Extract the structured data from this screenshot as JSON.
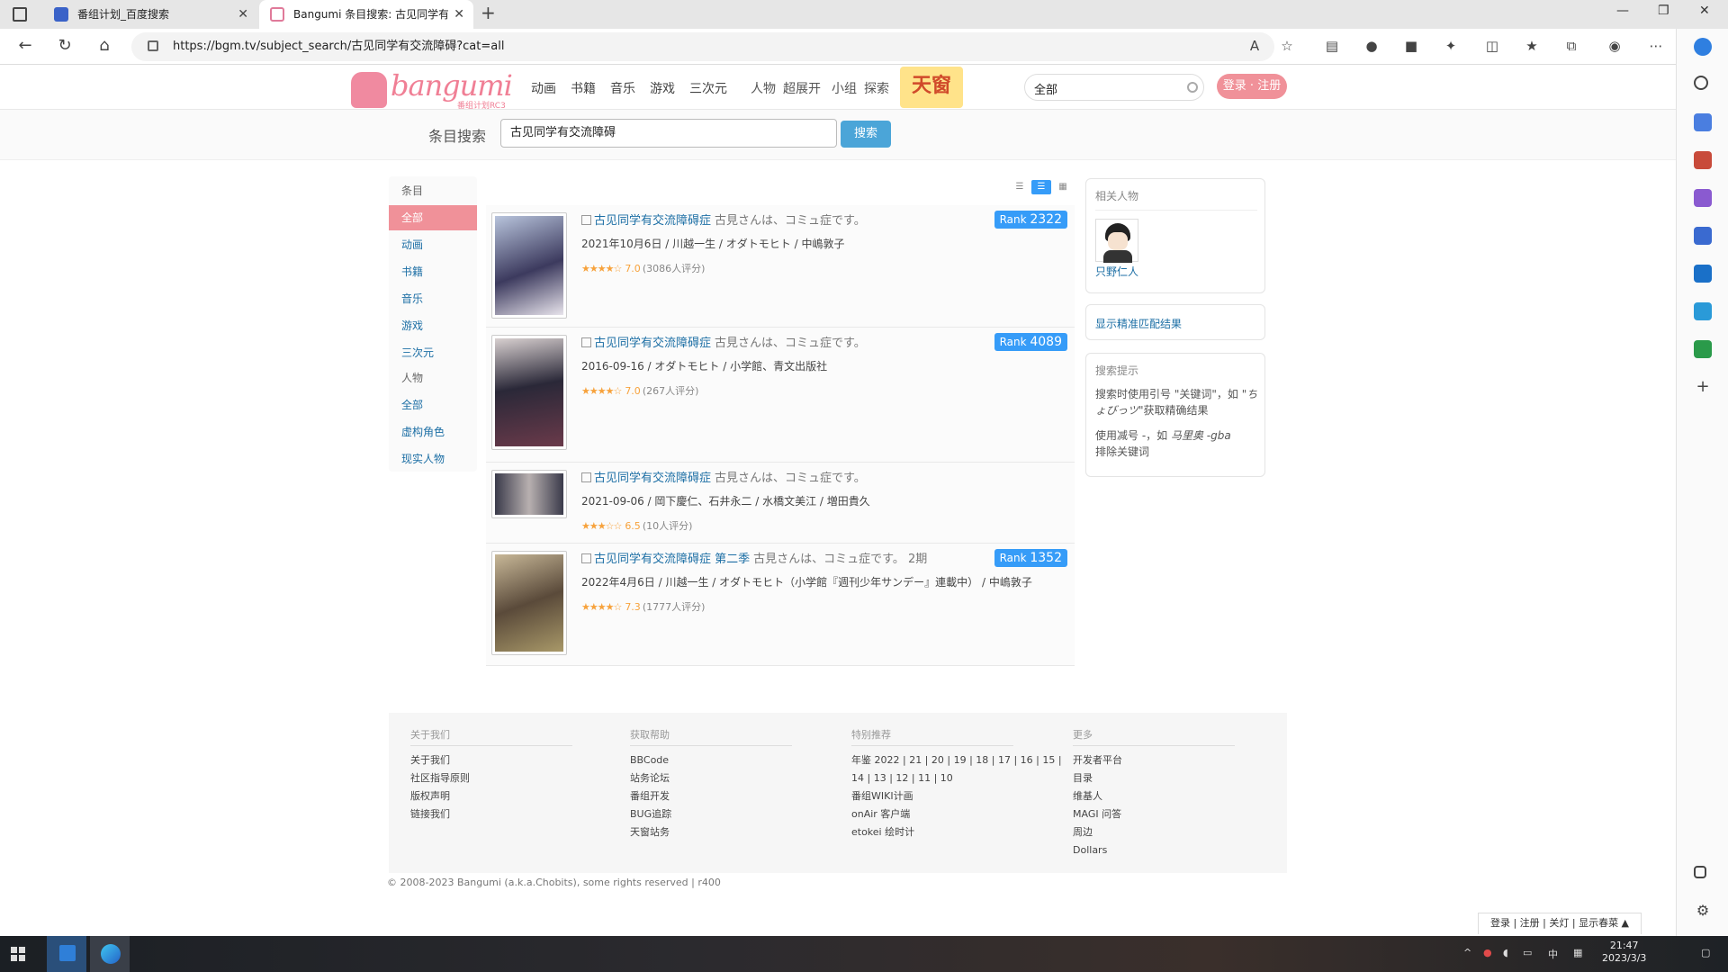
{
  "browser": {
    "tabs": [
      {
        "title": "番组计划_百度搜索"
      },
      {
        "title": "Bangumi 条目搜索: 古见同学有交流障碍症"
      }
    ],
    "url": "https://bgm.tv/subject_search/古见同学有交流障碍?cat=all",
    "icons": [
      "back-icon",
      "refresh-icon",
      "home-icon",
      "read-aloud-icon",
      "favorite-icon",
      "extensions-icon",
      "collections-icon",
      "profile-icon",
      "more-icon",
      "bing-icon"
    ]
  },
  "header": {
    "logo": "bangumi",
    "logo_sub": "番组计划RC3",
    "nav": [
      "动画",
      "书籍",
      "音乐",
      "游戏",
      "三次元"
    ],
    "nav2": [
      "人物",
      "超展开",
      "小组",
      "探索"
    ],
    "promo": "天窗",
    "search_category": "全部",
    "login": "登录 · 注册"
  },
  "searchbar": {
    "title": "条目搜索",
    "query": "古见同学有交流障碍",
    "button": "搜索"
  },
  "categories": [
    {
      "label": "条目",
      "type": "hd"
    },
    {
      "label": "全部",
      "type": "on"
    },
    {
      "label": "动画",
      "type": ""
    },
    {
      "label": "书籍",
      "type": ""
    },
    {
      "label": "音乐",
      "type": ""
    },
    {
      "label": "游戏",
      "type": ""
    },
    {
      "label": "三次元",
      "type": ""
    },
    {
      "label": "人物",
      "type": "hd"
    },
    {
      "label": "全部",
      "type": ""
    },
    {
      "label": "虚构角色",
      "type": ""
    },
    {
      "label": "现实人物",
      "type": ""
    }
  ],
  "results": [
    {
      "title": "古见同学有交流障碍症",
      "jp": "古見さんは、コミュ症です。",
      "info": "2021年10月6日 / 川越一生 / オダトモヒト / 中嶋敦子",
      "stars": 3.5,
      "score": "7.0",
      "votes": "(3086人评分)",
      "rank": "2322",
      "type_icon": "tv-icon"
    },
    {
      "title": "古见同学有交流障碍症",
      "jp": "古見さんは、コミュ症です。",
      "info": "2016-09-16 / オダトモヒト / 小学館、青文出版社",
      "stars": 3.5,
      "score": "7.0",
      "votes": "(267人评分)",
      "rank": "4089",
      "type_icon": "book-icon"
    },
    {
      "title": "古见同学有交流障碍症",
      "jp": "古見さんは、コミュ症です。",
      "info": "2021-09-06 / 岡下慶仁、石井永二 / 水橋文美江 / 増田貴久",
      "stars": 3,
      "score": "6.5",
      "votes": "(10人评分)",
      "rank": "",
      "type_icon": "real-icon"
    },
    {
      "title": "古见同学有交流障碍症 第二季",
      "jp": "古見さんは、コミュ症です。 2期",
      "info": "2022年4月6日 / 川越一生 / オダトモヒト（小学館『週刊少年サンデー』連載中） / 中嶋敦子",
      "stars": 3.5,
      "score": "7.3",
      "votes": "(1777人评分)",
      "rank": "1352",
      "type_icon": "tv-icon"
    }
  ],
  "sidebar": {
    "related_title": "相关人物",
    "person_name": "只野仁人",
    "exact_link": "显示精准匹配结果",
    "tips_title": "搜索提示",
    "tip1_a": "搜索时使用引号 \"关键词\"，如",
    "tip1_b": "\"ちょびっツ\"",
    "tip1_c": "获取精确结果",
    "tip2_a": "使用减号 -，如",
    "tip2_b": "马里奥 -gba",
    "tip2_c": "排除关键词"
  },
  "footer": {
    "cols": [
      {
        "title": "关于我们",
        "links": [
          "关于我们",
          "社区指导原则",
          "版权声明",
          "链接我们"
        ]
      },
      {
        "title": "获取帮助",
        "links": [
          "BBCode",
          "站务论坛",
          "番组开发",
          "BUG追踪",
          "天窗站务"
        ]
      },
      {
        "title": "特别推荐",
        "links": [
          "年鉴 2022 | 21 | 20 | 19 | 18 | 17 | 16 | 15 |",
          "14 | 13 | 12 | 11 | 10",
          "番组WIKI计画",
          "onAir 客户端",
          "etokei 绘时计"
        ]
      },
      {
        "title": "更多",
        "links": [
          "开发者平台",
          "目录",
          "维基人",
          "MAGI 问答",
          "周边",
          "Dollars"
        ]
      }
    ],
    "copyright": "© 2008-2023 Bangumi (a.k.a.Chobits), some rights reserved | r400",
    "bottom_bar": "登录 | 注册 | 关灯 | 显示春菜 ▲"
  },
  "taskbar": {
    "time": "21:47",
    "date": "2023/3/3"
  },
  "colors": {
    "accent": "#f09199",
    "link": "#1d6fa5",
    "rank": "#369cf8",
    "button": "#4ba5d8"
  }
}
